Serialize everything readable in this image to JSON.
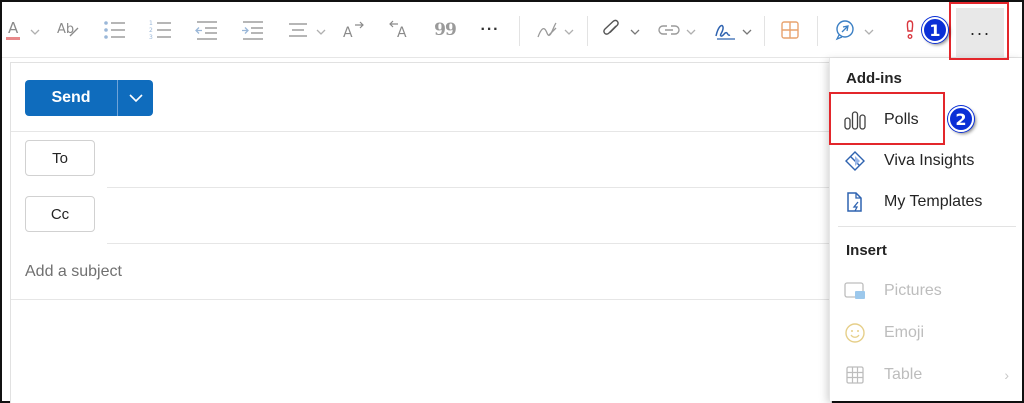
{
  "toolbar": {
    "more_label": "···",
    "more_dots": "···",
    "quote_glyph": "99"
  },
  "compose": {
    "send_label": "Send",
    "to_label": "To",
    "cc_label": "Cc",
    "subject_placeholder": "Add a subject"
  },
  "menu": {
    "addins_heading": "Add-ins",
    "addins": [
      {
        "label": "Polls",
        "icon": "polls-icon"
      },
      {
        "label": "Viva Insights",
        "icon": "viva-insights-icon"
      },
      {
        "label": "My Templates",
        "icon": "templates-icon"
      }
    ],
    "insert_heading": "Insert",
    "insert": [
      {
        "label": "Pictures",
        "icon": "picture-icon"
      },
      {
        "label": "Emoji",
        "icon": "emoji-icon"
      },
      {
        "label": "Table",
        "icon": "table-icon"
      }
    ]
  },
  "annotations": {
    "badge1": "1",
    "badge2": "2"
  },
  "colors": {
    "accent": "#0f6cbd",
    "annotation_red": "#e3262b",
    "badge_blue": "#0a2fd6"
  }
}
